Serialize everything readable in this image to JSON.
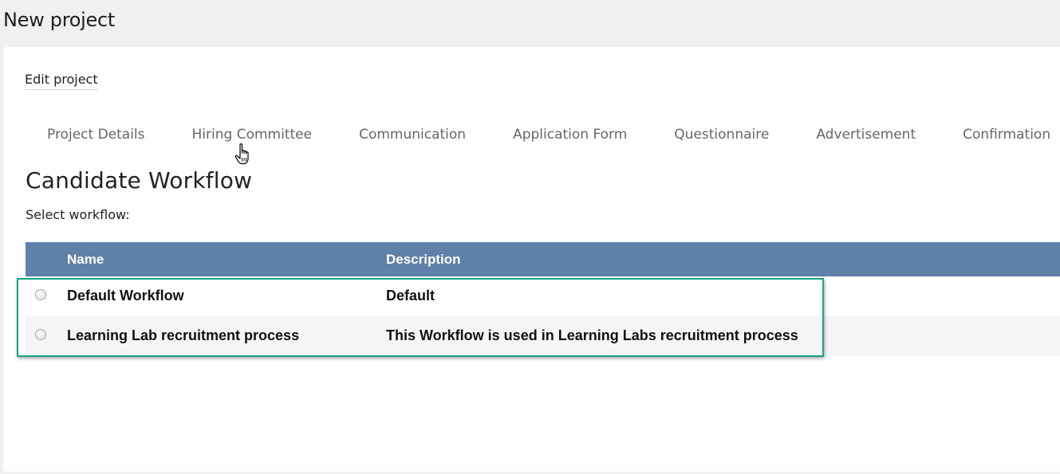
{
  "page": {
    "title": "New project"
  },
  "card": {
    "edit_label": "Edit project",
    "tabs": [
      {
        "label": "Project Details"
      },
      {
        "label": "Hiring Committee"
      },
      {
        "label": "Communication"
      },
      {
        "label": "Application Form"
      },
      {
        "label": "Questionnaire"
      },
      {
        "label": "Advertisement"
      },
      {
        "label": "Confirmation"
      }
    ],
    "section_heading": "Candidate Workflow",
    "select_label": "Select workflow:"
  },
  "table": {
    "columns": {
      "name": "Name",
      "description": "Description"
    },
    "rows": [
      {
        "name": "Default Workflow",
        "description": "Default",
        "selected": false
      },
      {
        "name": "Learning Lab recruitment process",
        "description": "This Workflow is used in Learning Labs recruitment process",
        "selected": false
      }
    ]
  },
  "colors": {
    "header_bg": "#5f80a8",
    "highlight_border": "#17a58a",
    "page_bg": "#f0f0f0"
  },
  "icons": {
    "cursor": "hand-pointer-icon",
    "radio": "radio-button-icon"
  }
}
